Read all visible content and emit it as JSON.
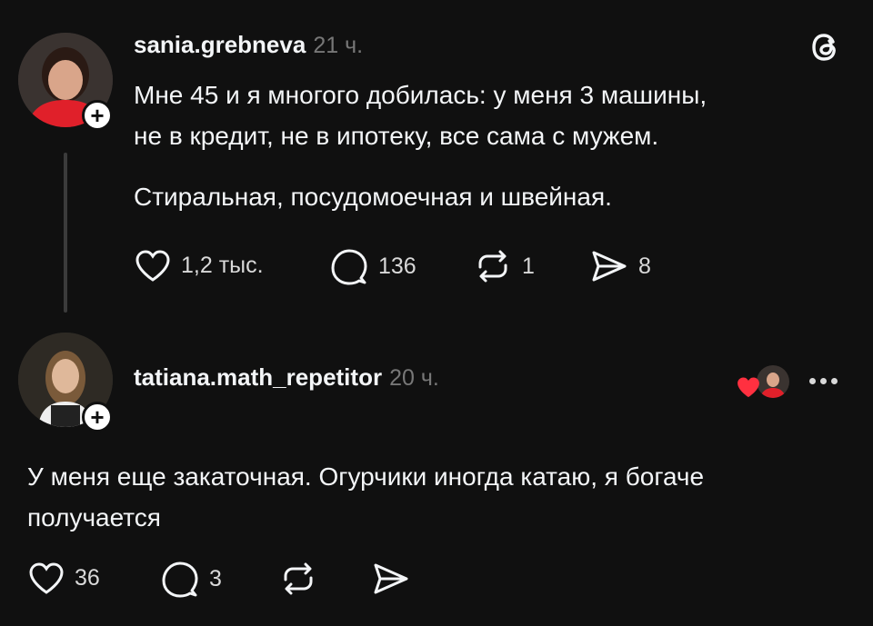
{
  "post": {
    "username": "sania.grebneva",
    "time": "21 ч.",
    "paragraphs": [
      "Мне 45 и я многого добилась: у меня 3 машины,",
      "не в кредит, не в ипотеку, все сама с мужем."
    ],
    "paragraph2": "Стиральная, посудомоечная и швейная.",
    "likes": "1,2 тыс.",
    "replies": "136",
    "reposts": "1",
    "shares": "8"
  },
  "reply": {
    "username": "tatiana.math_repetitor",
    "time": "20 ч.",
    "text_line1": "У меня еще закаточная. Огурчики иногда катаю, я богаче",
    "text_line2": "получается",
    "likes": "36",
    "replies": "3"
  },
  "icons": {
    "logo": "threads-logo-icon",
    "like": "heart-icon",
    "reply": "comment-icon",
    "repost": "repost-icon",
    "share": "send-icon",
    "more": "more-dots-icon"
  },
  "colors": {
    "background": "#101010",
    "text": "#f3f5f7",
    "muted": "#777777",
    "heart": "#ff3040"
  }
}
